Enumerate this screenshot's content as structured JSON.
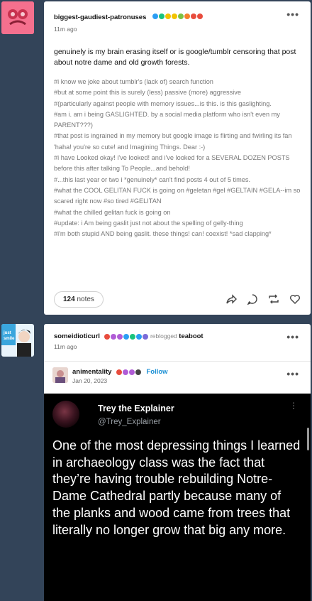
{
  "posts": [
    {
      "blog": "biggest-gaudiest-patronuses",
      "time": "11m ago",
      "body": "genuinely is my brain erasing itself or is google/tumblr censoring that post about notre dame and old growth forests.",
      "tags": [
        "#i know we joke about tumblr's (lack of) search function",
        "#but at some point this is surely (less) passive (more) aggressive",
        "#(particularly against people with memory issues...is this. is this gaslighting.",
        "#am i. am i being GASLIGHTED. by a social media platform who isn't even my PARENT???)",
        "#that post is ingrained in my memory but google image is flirting and fwirling its fan 'haha! you're so cute! and Imagining Things. Dear :-)",
        "#i have Looked okay! i've looked! and i've looked for a SEVERAL DOZEN POSTS before this after talking To People...and behold!",
        "#...this last year or two i *genuinely* can't find posts 4 out of 5 times.",
        "#what the COOL GELITAN FUCK is going on   #geletan   #gel   #GELTAIN   #GELA--im so scared right now   #so tired   #GELITAN",
        "#what the chilled gelitan fuck is going on",
        "#update: i Am being gaslit just not about the spelling of gelly-thing",
        "#i'm both stupid AND being gaslit. these things! can! coexist! *sad clapping*"
      ],
      "notes_count": "124",
      "notes_label": "notes"
    },
    {
      "blog": "someidioticurl",
      "reblogged_label": "reblogged",
      "reblogged_from": "teaboot",
      "time": "11m ago",
      "source_blog": "animentality",
      "source_date": "Jan 20, 2023",
      "follow_label": "Follow"
    }
  ],
  "tweet": {
    "name": "Trey the Explainer",
    "handle": "@Trey_Explainer",
    "text": "One of the most depressing things I learned in archaeology class was the fact that they’re having trouble rebuilding Notre-Dame Cathedral partly because many of the planks and wood came from trees that literally no longer grow that big any more."
  },
  "icons": [
    "more-icon",
    "share-icon",
    "reply-icon",
    "reblog-icon",
    "heart-icon"
  ],
  "colors": {
    "follow": "#1a8fd4",
    "page_bg": "#334459"
  }
}
